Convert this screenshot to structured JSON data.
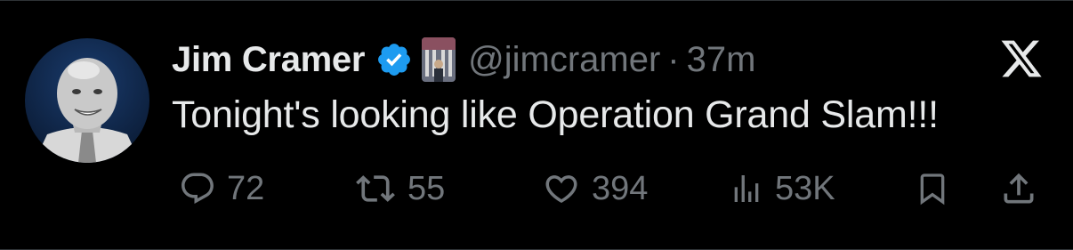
{
  "tweet": {
    "author": {
      "display_name": "Jim Cramer",
      "handle": "@jimcramer",
      "verified": true,
      "avatar_icon": "profile-photo",
      "affiliation_icon": "stock-exchange-badge"
    },
    "separator": "·",
    "timestamp": "37m",
    "text": "Tonight's looking like Operation Grand Slam!!!",
    "brand_icon": "x-logo-icon"
  },
  "actions": {
    "reply": {
      "icon": "reply-icon",
      "count": "72"
    },
    "retweet": {
      "icon": "retweet-icon",
      "count": "55"
    },
    "like": {
      "icon": "heart-icon",
      "count": "394"
    },
    "views": {
      "icon": "views-icon",
      "count": "53K"
    },
    "bookmark": {
      "icon": "bookmark-icon"
    },
    "share": {
      "icon": "share-icon"
    }
  },
  "colors": {
    "background": "#000000",
    "text_primary": "#e7e9ea",
    "text_secondary": "#71767b",
    "verified_blue": "#1d9bf0"
  }
}
